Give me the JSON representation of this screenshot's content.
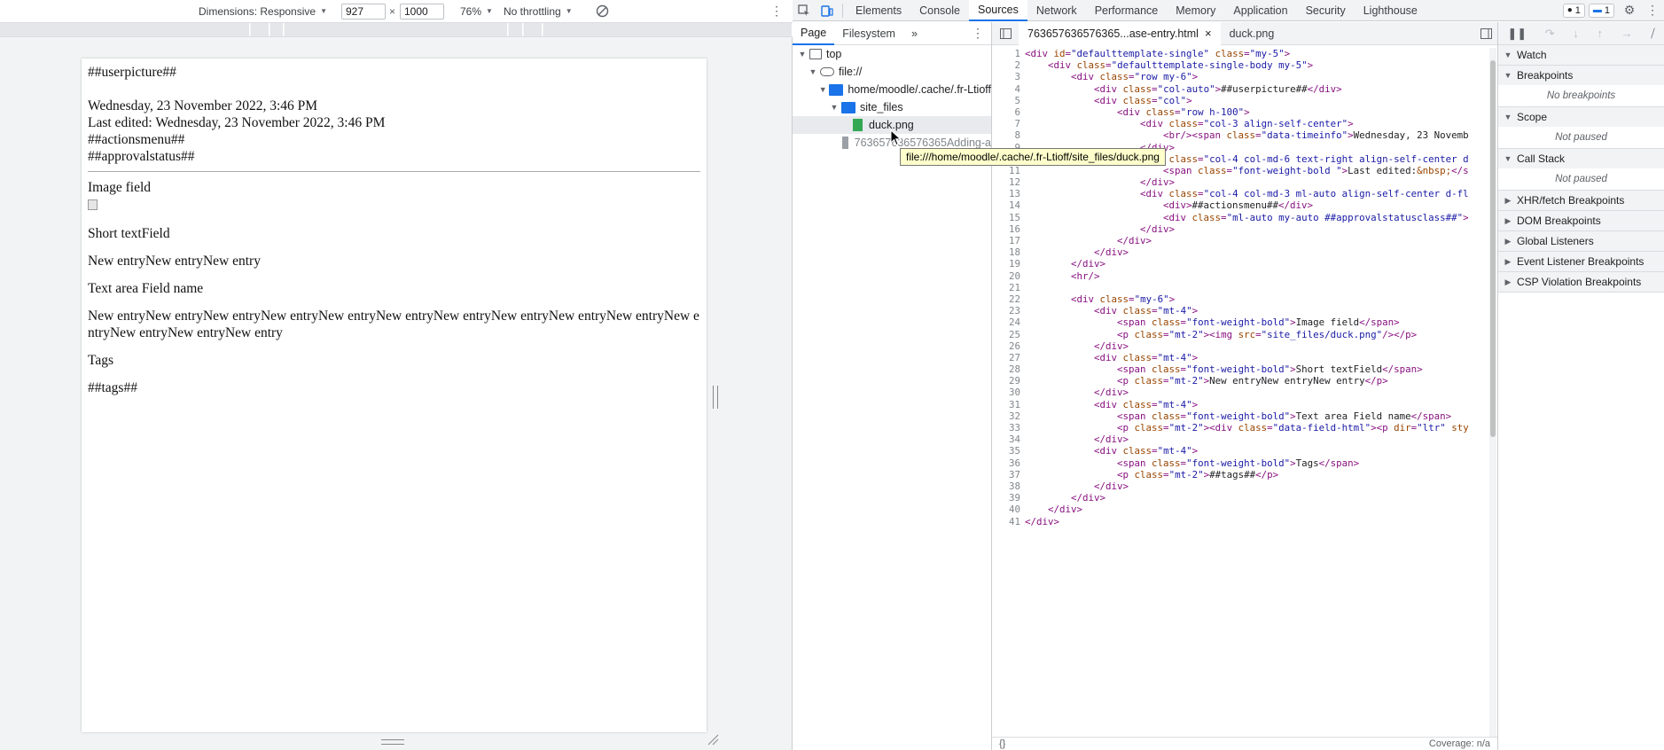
{
  "device_toolbar": {
    "dimensions_label": "Dimensions: Responsive",
    "width": "927",
    "times": "×",
    "height": "1000",
    "zoom": "76%",
    "throttling": "No throttling"
  },
  "page": {
    "user_picture": "##userpicture##",
    "time_info": "Wednesday, 23 November 2022, 3:46 PM",
    "last_edited": "Last edited: Wednesday, 23 November 2022, 3:46 PM",
    "actions_menu": "##actionsmenu##",
    "approval_status": "##approvalstatus##",
    "image_field_label": "Image field",
    "short_text_label": "Short textField",
    "short_text_value": "New entryNew entryNew entry",
    "text_area_label": "Text area Field name",
    "text_area_value": "New entryNew entryNew entryNew entryNew entryNew entryNew entryNew entryNew entryNew entryNew entryNew entryNew entryNew entry",
    "tags_label": "Tags",
    "tags_value": "##tags##"
  },
  "devtools": {
    "tabs": [
      "Elements",
      "Console",
      "Sources",
      "Network",
      "Performance",
      "Memory",
      "Application",
      "Security",
      "Lighthouse"
    ],
    "active_tab": "Sources",
    "errors_count": "1",
    "messages_count": "1"
  },
  "navigator": {
    "tabs": [
      "Page",
      "Filesystem"
    ],
    "more": "»",
    "tree": [
      {
        "label": "top",
        "icon": "frame-icon"
      },
      {
        "label": "file://",
        "icon": "cloud-icon"
      },
      {
        "label": "home/moodle/.cache/.fr-Ltioff",
        "icon": "folder-icon"
      },
      {
        "label": "site_files",
        "icon": "folder-icon"
      },
      {
        "label": "duck.png",
        "icon": "image-file-icon"
      },
      {
        "label": "763657636576365Adding-a",
        "icon": "file-icon"
      }
    ]
  },
  "tooltip": "file:///home/moodle/.cache/.fr-Ltioff/site_files/duck.png",
  "editor": {
    "tabs": [
      {
        "label": "763657636576365...ase-entry.html",
        "closable": true
      },
      {
        "label": "duck.png",
        "closable": false
      }
    ]
  },
  "code_lines": [
    {
      "indent": 0,
      "segs": [
        [
          "t",
          "<div "
        ],
        [
          "a",
          "id"
        ],
        [
          "t",
          "="
        ],
        [
          "v",
          "\"defaulttemplate-single\""
        ],
        [
          "t",
          " "
        ],
        [
          "a",
          "class"
        ],
        [
          "t",
          "="
        ],
        [
          "v",
          "\"my-5\""
        ],
        [
          "t",
          ">"
        ]
      ]
    },
    {
      "indent": 4,
      "segs": [
        [
          "t",
          "<div "
        ],
        [
          "a",
          "class"
        ],
        [
          "t",
          "="
        ],
        [
          "v",
          "\"defaulttemplate-single-body my-5\""
        ],
        [
          "t",
          ">"
        ]
      ]
    },
    {
      "indent": 8,
      "segs": [
        [
          "t",
          "<div "
        ],
        [
          "a",
          "class"
        ],
        [
          "t",
          "="
        ],
        [
          "v",
          "\"row my-6\""
        ],
        [
          "t",
          ">"
        ]
      ]
    },
    {
      "indent": 12,
      "segs": [
        [
          "t",
          "<div "
        ],
        [
          "a",
          "class"
        ],
        [
          "t",
          "="
        ],
        [
          "v",
          "\"col-auto\""
        ],
        [
          "t",
          ">"
        ],
        [
          "c",
          "##userpicture##"
        ],
        [
          "t",
          "</div>"
        ]
      ]
    },
    {
      "indent": 12,
      "segs": [
        [
          "t",
          "<div "
        ],
        [
          "a",
          "class"
        ],
        [
          "t",
          "="
        ],
        [
          "v",
          "\"col\""
        ],
        [
          "t",
          ">"
        ]
      ]
    },
    {
      "indent": 16,
      "segs": [
        [
          "t",
          "<div "
        ],
        [
          "a",
          "class"
        ],
        [
          "t",
          "="
        ],
        [
          "v",
          "\"row h-100\""
        ],
        [
          "t",
          ">"
        ]
      ]
    },
    {
      "indent": 20,
      "segs": [
        [
          "t",
          "<div "
        ],
        [
          "a",
          "class"
        ],
        [
          "t",
          "="
        ],
        [
          "v",
          "\"col-3 align-self-center\""
        ],
        [
          "t",
          ">"
        ]
      ]
    },
    {
      "indent": 24,
      "segs": [
        [
          "t",
          "<br/><span "
        ],
        [
          "a",
          "class"
        ],
        [
          "t",
          "="
        ],
        [
          "v",
          "\"data-timeinfo\""
        ],
        [
          "t",
          ">"
        ],
        [
          "c",
          "Wednesday, 23 Novemb"
        ]
      ]
    },
    {
      "indent": 20,
      "segs": [
        [
          "t",
          "</div>"
        ]
      ]
    },
    {
      "indent": 20,
      "segs": [
        [
          "t",
          "<div "
        ],
        [
          "a",
          "class"
        ],
        [
          "t",
          "="
        ],
        [
          "v",
          "\"col-4 col-md-6 text-right align-self-center d"
        ]
      ]
    },
    {
      "indent": 24,
      "segs": [
        [
          "t",
          "<span "
        ],
        [
          "a",
          "class"
        ],
        [
          "t",
          "="
        ],
        [
          "v",
          "\"font-weight-bold \""
        ],
        [
          "t",
          ">"
        ],
        [
          "c",
          "Last edited:"
        ],
        [
          "a",
          "&nbsp;"
        ],
        [
          "t",
          "</s"
        ]
      ]
    },
    {
      "indent": 20,
      "segs": [
        [
          "t",
          "</div>"
        ]
      ]
    },
    {
      "indent": 20,
      "segs": [
        [
          "t",
          "<div "
        ],
        [
          "a",
          "class"
        ],
        [
          "t",
          "="
        ],
        [
          "v",
          "\"col-4 col-md-3 ml-auto align-self-center d-fl"
        ]
      ]
    },
    {
      "indent": 24,
      "segs": [
        [
          "t",
          "<div>"
        ],
        [
          "c",
          "##actionsmenu##"
        ],
        [
          "t",
          "</div>"
        ]
      ]
    },
    {
      "indent": 24,
      "segs": [
        [
          "t",
          "<div "
        ],
        [
          "a",
          "class"
        ],
        [
          "t",
          "="
        ],
        [
          "v",
          "\"ml-auto my-auto ##approvalstatusclass##\""
        ],
        [
          "t",
          ">"
        ]
      ]
    },
    {
      "indent": 20,
      "segs": [
        [
          "t",
          "</div>"
        ]
      ]
    },
    {
      "indent": 16,
      "segs": [
        [
          "t",
          "</div>"
        ]
      ]
    },
    {
      "indent": 12,
      "segs": [
        [
          "t",
          "</div>"
        ]
      ]
    },
    {
      "indent": 8,
      "segs": [
        [
          "t",
          "</div>"
        ]
      ]
    },
    {
      "indent": 8,
      "segs": [
        [
          "t",
          "<hr/>"
        ]
      ]
    },
    {
      "indent": 0,
      "segs": []
    },
    {
      "indent": 8,
      "segs": [
        [
          "t",
          "<div "
        ],
        [
          "a",
          "class"
        ],
        [
          "t",
          "="
        ],
        [
          "v",
          "\"my-6\""
        ],
        [
          "t",
          ">"
        ]
      ]
    },
    {
      "indent": 12,
      "segs": [
        [
          "t",
          "<div "
        ],
        [
          "a",
          "class"
        ],
        [
          "t",
          "="
        ],
        [
          "v",
          "\"mt-4\""
        ],
        [
          "t",
          ">"
        ]
      ]
    },
    {
      "indent": 16,
      "segs": [
        [
          "t",
          "<span "
        ],
        [
          "a",
          "class"
        ],
        [
          "t",
          "="
        ],
        [
          "v",
          "\"font-weight-bold\""
        ],
        [
          "t",
          ">"
        ],
        [
          "c",
          "Image field"
        ],
        [
          "t",
          "</span>"
        ]
      ]
    },
    {
      "indent": 16,
      "segs": [
        [
          "t",
          "<p "
        ],
        [
          "a",
          "class"
        ],
        [
          "t",
          "="
        ],
        [
          "v",
          "\"mt-2\""
        ],
        [
          "t",
          "><img "
        ],
        [
          "a",
          "src"
        ],
        [
          "t",
          "="
        ],
        [
          "v",
          "\"site_files/duck.png\""
        ],
        [
          "t",
          "/></p>"
        ]
      ]
    },
    {
      "indent": 12,
      "segs": [
        [
          "t",
          "</div>"
        ]
      ]
    },
    {
      "indent": 12,
      "segs": [
        [
          "t",
          "<div "
        ],
        [
          "a",
          "class"
        ],
        [
          "t",
          "="
        ],
        [
          "v",
          "\"mt-4\""
        ],
        [
          "t",
          ">"
        ]
      ]
    },
    {
      "indent": 16,
      "segs": [
        [
          "t",
          "<span "
        ],
        [
          "a",
          "class"
        ],
        [
          "t",
          "="
        ],
        [
          "v",
          "\"font-weight-bold\""
        ],
        [
          "t",
          ">"
        ],
        [
          "c",
          "Short textField"
        ],
        [
          "t",
          "</span>"
        ]
      ]
    },
    {
      "indent": 16,
      "segs": [
        [
          "t",
          "<p "
        ],
        [
          "a",
          "class"
        ],
        [
          "t",
          "="
        ],
        [
          "v",
          "\"mt-2\""
        ],
        [
          "t",
          ">"
        ],
        [
          "c",
          "New entryNew entryNew entry"
        ],
        [
          "t",
          "</p>"
        ]
      ]
    },
    {
      "indent": 12,
      "segs": [
        [
          "t",
          "</div>"
        ]
      ]
    },
    {
      "indent": 12,
      "segs": [
        [
          "t",
          "<div "
        ],
        [
          "a",
          "class"
        ],
        [
          "t",
          "="
        ],
        [
          "v",
          "\"mt-4\""
        ],
        [
          "t",
          ">"
        ]
      ]
    },
    {
      "indent": 16,
      "segs": [
        [
          "t",
          "<span "
        ],
        [
          "a",
          "class"
        ],
        [
          "t",
          "="
        ],
        [
          "v",
          "\"font-weight-bold\""
        ],
        [
          "t",
          ">"
        ],
        [
          "c",
          "Text area Field name"
        ],
        [
          "t",
          "</span>"
        ]
      ]
    },
    {
      "indent": 16,
      "segs": [
        [
          "t",
          "<p "
        ],
        [
          "a",
          "class"
        ],
        [
          "t",
          "="
        ],
        [
          "v",
          "\"mt-2\""
        ],
        [
          "t",
          "><div "
        ],
        [
          "a",
          "class"
        ],
        [
          "t",
          "="
        ],
        [
          "v",
          "\"data-field-html\""
        ],
        [
          "t",
          "><p "
        ],
        [
          "a",
          "dir"
        ],
        [
          "t",
          "="
        ],
        [
          "v",
          "\"ltr\""
        ],
        [
          "t",
          " "
        ],
        [
          "a",
          "sty"
        ]
      ]
    },
    {
      "indent": 12,
      "segs": [
        [
          "t",
          "</div>"
        ]
      ]
    },
    {
      "indent": 12,
      "segs": [
        [
          "t",
          "<div "
        ],
        [
          "a",
          "class"
        ],
        [
          "t",
          "="
        ],
        [
          "v",
          "\"mt-4\""
        ],
        [
          "t",
          ">"
        ]
      ]
    },
    {
      "indent": 16,
      "segs": [
        [
          "t",
          "<span "
        ],
        [
          "a",
          "class"
        ],
        [
          "t",
          "="
        ],
        [
          "v",
          "\"font-weight-bold\""
        ],
        [
          "t",
          ">"
        ],
        [
          "c",
          "Tags"
        ],
        [
          "t",
          "</span>"
        ]
      ]
    },
    {
      "indent": 16,
      "segs": [
        [
          "t",
          "<p "
        ],
        [
          "a",
          "class"
        ],
        [
          "t",
          "="
        ],
        [
          "v",
          "\"mt-2\""
        ],
        [
          "t",
          ">"
        ],
        [
          "c",
          "##tags##"
        ],
        [
          "t",
          "</p>"
        ]
      ]
    },
    {
      "indent": 12,
      "segs": [
        [
          "t",
          "</div>"
        ]
      ]
    },
    {
      "indent": 8,
      "segs": [
        [
          "t",
          "</div>"
        ]
      ]
    },
    {
      "indent": 4,
      "segs": [
        [
          "t",
          "</div>"
        ]
      ]
    },
    {
      "indent": 0,
      "segs": [
        [
          "t",
          "</div>"
        ]
      ]
    }
  ],
  "status_bar": {
    "left": "{}",
    "right": "Coverage: n/a"
  },
  "debugger": {
    "sections": [
      {
        "title": "Watch",
        "expanded": true,
        "body": ""
      },
      {
        "title": "Breakpoints",
        "expanded": true,
        "body": "No breakpoints"
      },
      {
        "title": "Scope",
        "expanded": true,
        "body": "Not paused"
      },
      {
        "title": "Call Stack",
        "expanded": true,
        "body": "Not paused"
      },
      {
        "title": "XHR/fetch Breakpoints",
        "expanded": false,
        "body": ""
      },
      {
        "title": "DOM Breakpoints",
        "expanded": false,
        "body": ""
      },
      {
        "title": "Global Listeners",
        "expanded": false,
        "body": ""
      },
      {
        "title": "Event Listener Breakpoints",
        "expanded": false,
        "body": ""
      },
      {
        "title": "CSP Violation Breakpoints",
        "expanded": false,
        "body": ""
      }
    ]
  },
  "colors": {
    "accent": "#1a73e8",
    "tag": "#881280",
    "attr": "#994500",
    "value": "#1a1aa6",
    "tooltip_bg": "#ffffcc"
  }
}
